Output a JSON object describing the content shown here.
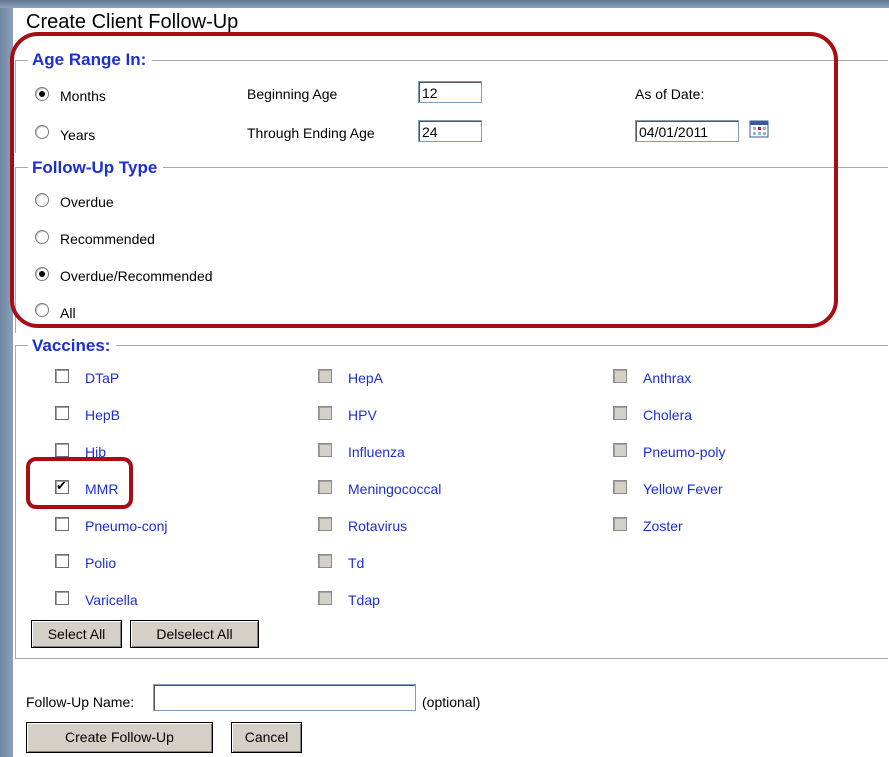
{
  "title": "Create Client Follow-Up",
  "age_range": {
    "legend": "Age Range In:",
    "months_label": "Months",
    "years_label": "Years",
    "months_checked": true,
    "beginning_age_label": "Beginning Age",
    "beginning_age_value": "12",
    "ending_age_label": "Through Ending Age",
    "ending_age_value": "24",
    "as_of_label": "As of Date:",
    "as_of_value": "04/01/2011",
    "calendar_icon": "calendar-icon"
  },
  "followup_type": {
    "legend": "Follow-Up Type",
    "options": [
      "Overdue",
      "Recommended",
      "Overdue/Recommended",
      "All"
    ],
    "selected": "Overdue/Recommended"
  },
  "vaccines": {
    "legend": "Vaccines:",
    "col1": [
      "DTaP",
      "HepB",
      "Hib",
      "MMR",
      "Pneumo-conj",
      "Polio",
      "Varicella"
    ],
    "col2": [
      "HepA",
      "HPV",
      "Influenza",
      "Meningococcal",
      "Rotavirus",
      "Td",
      "Tdap"
    ],
    "col3": [
      "Anthrax",
      "Cholera",
      "Pneumo-poly",
      "Yellow Fever",
      "Zoster"
    ],
    "checked": [
      "MMR"
    ],
    "select_all": "Select All",
    "deselect_all": "Delselect All"
  },
  "followup_name": {
    "label": "Follow-Up Name:",
    "value": "",
    "optional": "(optional)"
  },
  "buttons": {
    "create": "Create Follow-Up",
    "cancel": "Cancel"
  },
  "colors": {
    "link": "#1c2fd4",
    "highlight": "#a80c14"
  }
}
